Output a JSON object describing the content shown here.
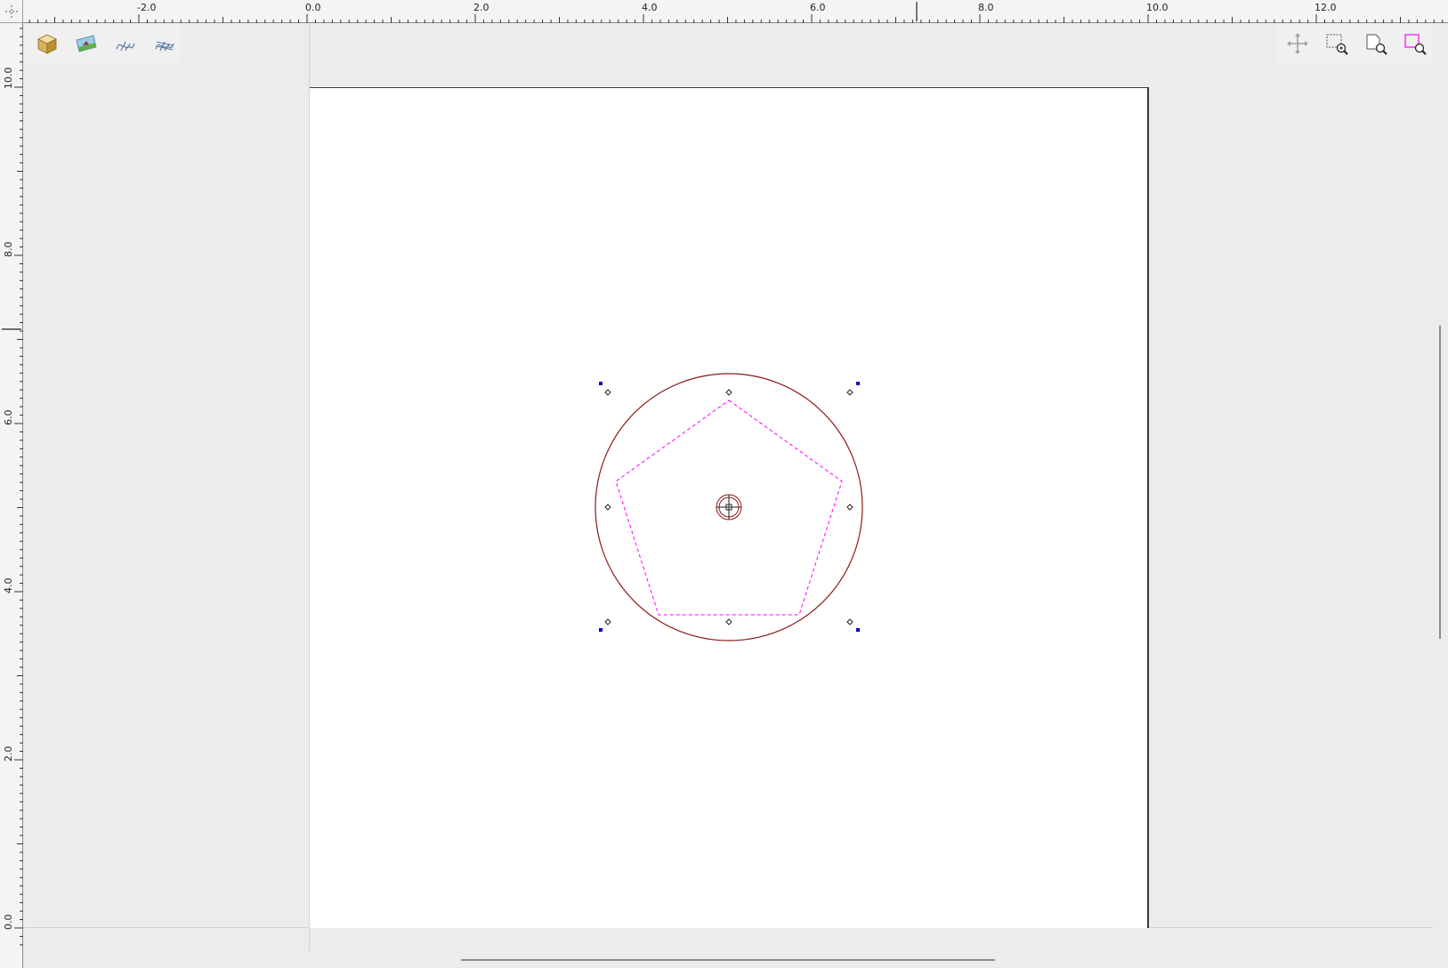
{
  "rulers": {
    "horizontal_labels": [
      "-2.0",
      "0.0",
      "2.0",
      "4.0",
      "6.0",
      "8.0",
      "10.0",
      "12.0"
    ],
    "vertical_labels": [
      "10.0",
      "8.0",
      "6.0",
      "4.0",
      "2.0",
      "0.0"
    ]
  },
  "toolbar_left": [
    {
      "name": "cube-icon",
      "title": "3D Object"
    },
    {
      "name": "image-icon",
      "title": "Image"
    },
    {
      "name": "wave-lines-icon",
      "title": "Lines"
    },
    {
      "name": "wave-hatch-icon",
      "title": "Hatch"
    }
  ],
  "toolbar_right": [
    {
      "name": "pan-icon",
      "title": "Pan"
    },
    {
      "name": "zoom-selection-icon",
      "title": "Zoom Selection"
    },
    {
      "name": "zoom-page-icon",
      "title": "Zoom Page"
    },
    {
      "name": "zoom-objects-icon",
      "title": "Zoom Objects"
    }
  ],
  "colors": {
    "circle": "#8b1a1a",
    "polygon": "#ff00ff",
    "handle": "#0000cc",
    "page_border": "#3a3a3a"
  }
}
